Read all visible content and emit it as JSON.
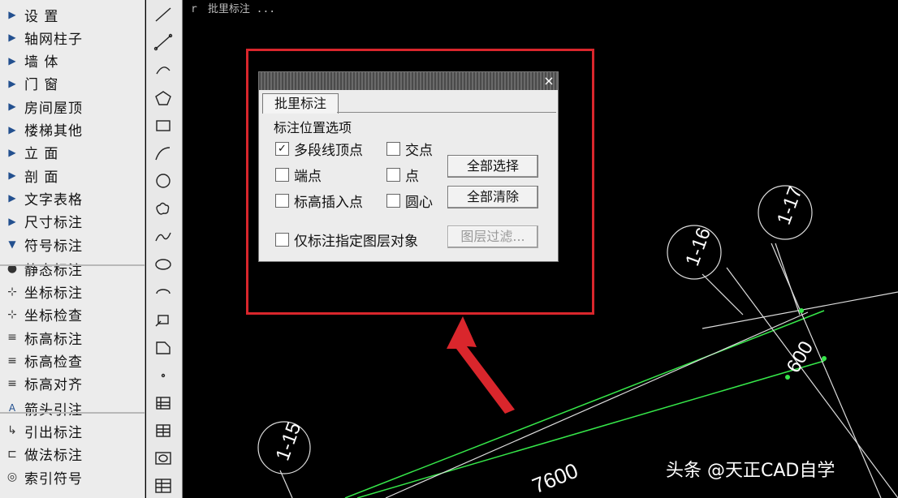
{
  "window": {
    "title_fragment": "r　批里标注 ..."
  },
  "menu": {
    "items": [
      {
        "label": "设 置",
        "icon": "arrow-right",
        "spread": true
      },
      {
        "label": "轴网柱子",
        "icon": "arrow-right"
      },
      {
        "label": "墙 体",
        "icon": "arrow-right",
        "spread": true
      },
      {
        "label": "门 窗",
        "icon": "arrow-right",
        "spread": true
      },
      {
        "label": "房间屋顶",
        "icon": "arrow-right"
      },
      {
        "label": "楼梯其他",
        "icon": "arrow-right"
      },
      {
        "label": "立 面",
        "icon": "arrow-right",
        "spread": true
      },
      {
        "label": "剖 面",
        "icon": "arrow-right",
        "spread": true
      },
      {
        "label": "文字表格",
        "icon": "arrow-right"
      },
      {
        "label": "尺寸标注",
        "icon": "arrow-right"
      },
      {
        "label": "符号标注",
        "icon": "arrow-down"
      },
      {
        "label": "静态标注",
        "icon": "bulb-icon"
      },
      {
        "label": "坐标标注",
        "icon": "coord-icon"
      },
      {
        "label": "坐标检查",
        "icon": "coord-check-icon"
      },
      {
        "label": "标高标注",
        "icon": "elevation-icon"
      },
      {
        "label": "标高检查",
        "icon": "elevation-check-icon"
      },
      {
        "label": "标高对齐",
        "icon": "elevation-align-icon"
      },
      {
        "label": "箭头引注",
        "icon": "arrow-note-icon"
      },
      {
        "label": "引出标注",
        "icon": "leader-icon"
      },
      {
        "label": "做法标注",
        "icon": "method-icon"
      },
      {
        "label": "索引符号",
        "icon": "index-icon"
      }
    ]
  },
  "toolbar": {
    "tools": [
      "line-tool-icon",
      "polyline-tool-icon",
      "arc-tool-icon",
      "polygon-tool-icon",
      "rectangle-tool-icon",
      "spline-tool-icon",
      "circle-tool-icon",
      "cloud-tool-icon",
      "wave-tool-icon",
      "ellipse-tool-icon",
      "ellipse-arc-tool-icon",
      "insert-block-icon",
      "make-block-icon",
      "point-icon",
      "hatch-icon",
      "hatch-edit-icon",
      "region-icon",
      "table-icon"
    ]
  },
  "dialog": {
    "title": "",
    "close_label": "×",
    "tab_label": "批里标注",
    "group_title": "标注位置选项",
    "options": [
      {
        "label": "多段线顶点",
        "checked": true
      },
      {
        "label": "交点",
        "checked": false
      },
      {
        "label": "端点",
        "checked": false
      },
      {
        "label": "点",
        "checked": false
      },
      {
        "label": "标高插入点",
        "checked": false
      },
      {
        "label": "圆心",
        "checked": false
      }
    ],
    "layer_only_label": "仅标注指定图层对象",
    "layer_only_checked": false,
    "select_all_label": "全部选择",
    "clear_all_label": "全部清除",
    "layer_filter_label": "图层过滤..."
  },
  "drawing": {
    "bubbles": [
      "1-17",
      "1-16",
      "1-15"
    ],
    "dims": [
      "600",
      "7600"
    ]
  },
  "colors": {
    "highlight": "#d9262c",
    "grid_green": "#36e84a"
  },
  "watermark": "头条 @天正CAD自学"
}
